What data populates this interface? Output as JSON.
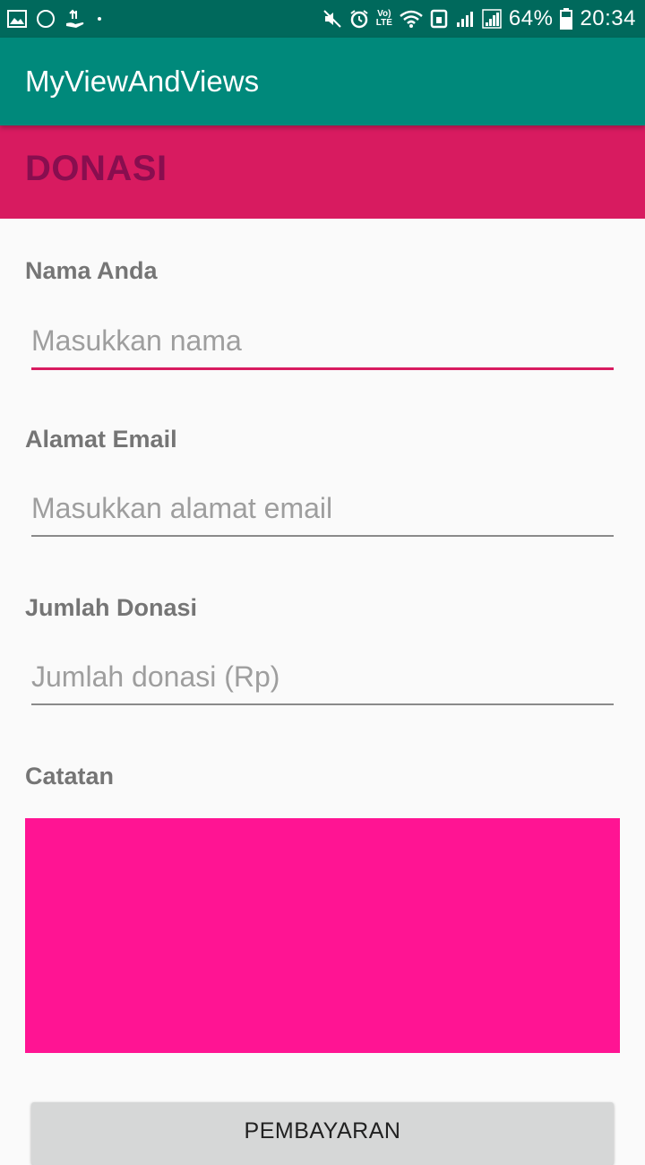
{
  "status_bar": {
    "battery": "64%",
    "time": "20:34",
    "left_icons": [
      "image-icon",
      "circle-icon",
      "hand-money-icon",
      "dot-icon"
    ],
    "right_icons": [
      "mute-icon",
      "alarm-icon",
      "volte-icon",
      "wifi-icon",
      "nfc-icon",
      "signal-icon",
      "signal-icon",
      "battery-icon"
    ],
    "volte_top": "Vo)",
    "volte_bottom": "LTE"
  },
  "app_bar": {
    "title": "MyViewAndViews"
  },
  "header": {
    "title": "DONASI"
  },
  "form": {
    "name_label": "Nama Anda",
    "name_placeholder": "Masukkan nama",
    "name_value": "",
    "email_label": "Alamat Email",
    "email_placeholder": "Masukkan alamat email",
    "email_value": "",
    "amount_label": "Jumlah Donasi",
    "amount_placeholder": "Jumlah donasi (Rp)",
    "amount_value": "",
    "notes_label": "Catatan",
    "notes_value": "",
    "submit_label": "PEMBAYARAN"
  },
  "colors": {
    "status_bar": "#00695c",
    "app_bar": "#00897b",
    "header_band": "#d81b60",
    "header_text": "#880e4f",
    "accent": "#d81b60",
    "notes_background": "#ff1493",
    "button": "#d6d7d7"
  }
}
